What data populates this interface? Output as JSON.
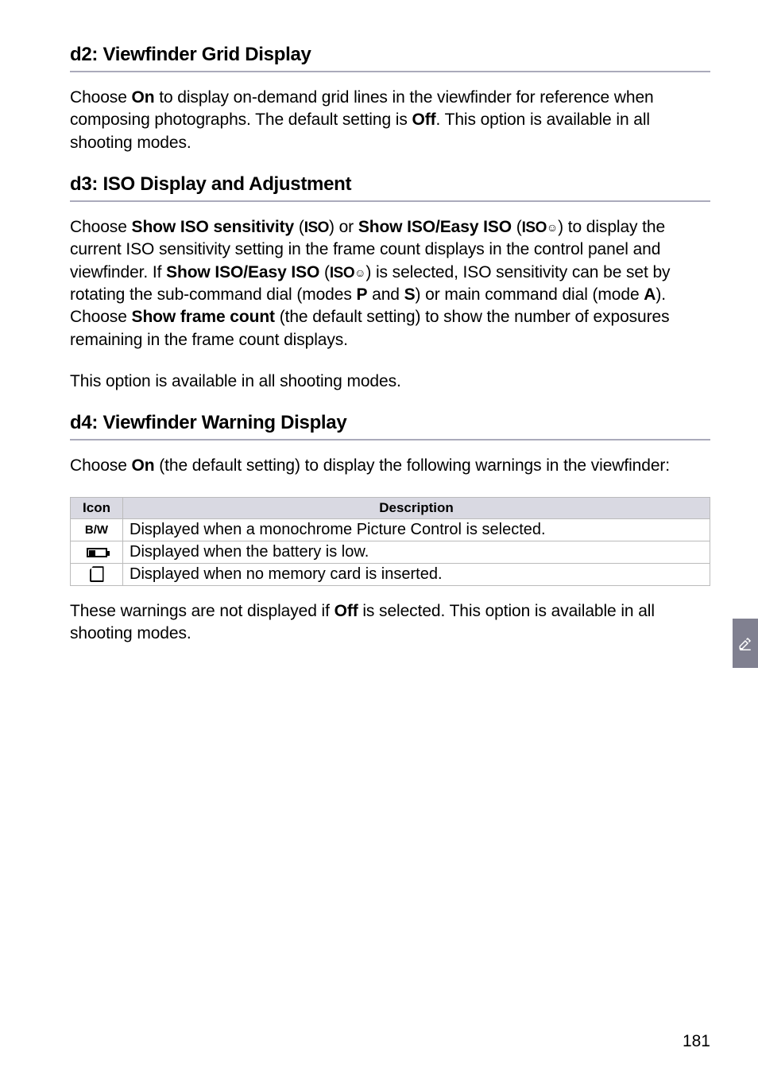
{
  "section_d2": {
    "heading": "d2: Viewfinder Grid Display",
    "para_parts": {
      "p1": "Choose ",
      "on": "On",
      "p2": " to display on-demand grid lines in the viewfinder for reference when composing photographs.  The default setting is ",
      "off": "Off",
      "p3": ".  This option is available in all shooting modes."
    }
  },
  "section_d3": {
    "heading": "d3: ISO Display and Adjustment",
    "para_parts": {
      "p1": "Choose ",
      "b1": "Show ISO sensitivity",
      "p2": " (",
      "iso1": "ISO",
      "p3": ") or ",
      "b2": "Show ISO/Easy ISO",
      "p4": " (",
      "iso2": "ISO",
      "iso2sub": "☺",
      "p5": ") to display the current ISO sensitivity setting in the frame count displays in the control panel and viewfinder.  If ",
      "b3": "Show ISO/Easy ISO",
      "p6": " (",
      "iso3": "ISO",
      "iso3sub": "☺",
      "p7": ")  is selected, ISO sensitivity can be set by rotating the sub-command dial (modes ",
      "modeP": "P",
      "p8": " and ",
      "modeS": "S",
      "p9": ") or main command dial (mode ",
      "modeA": "A",
      "p10": "). Choose ",
      "b4": "Show frame count",
      "p11": " (the default setting) to show the number of exposures remaining in the frame count displays."
    },
    "para2": "This option is available in all shooting modes."
  },
  "section_d4": {
    "heading": "d4: Viewfinder Warning Display",
    "intro_parts": {
      "p1": "Choose ",
      "on": "On",
      "p2": " (the default setting) to display the following warnings in the viewfinder:"
    },
    "table": {
      "head_icon": "Icon",
      "head_desc": "Description",
      "rows": [
        {
          "icon_text": "B/W",
          "desc": "Displayed when a monochrome Picture Control is selected."
        },
        {
          "icon_text": "battery",
          "desc": "Displayed when the battery is low."
        },
        {
          "icon_text": "card",
          "desc": "Displayed when no memory card is inserted."
        }
      ]
    },
    "outro_parts": {
      "p1": "These warnings are not displayed if ",
      "off": "Off",
      "p2": " is selected.  This option is available in all shooting modes."
    }
  },
  "page_number": "181"
}
